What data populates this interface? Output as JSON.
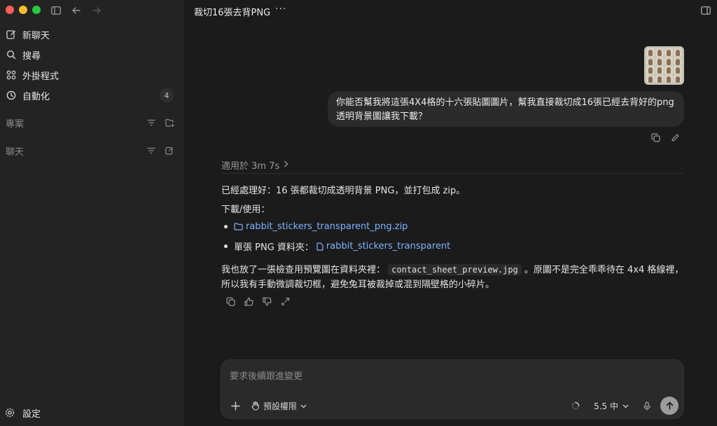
{
  "sidebar": {
    "items": [
      {
        "label": "新聊天",
        "icon": "new-chat-icon"
      },
      {
        "label": "搜尋",
        "icon": "search-icon"
      },
      {
        "label": "外掛程式",
        "icon": "plugins-icon"
      },
      {
        "label": "自動化",
        "icon": "clock-icon",
        "badge": "4"
      }
    ],
    "sections": [
      {
        "label": "專案"
      },
      {
        "label": "聊天"
      }
    ],
    "settings_label": "設定"
  },
  "header": {
    "title": "裁切16張去背PNG",
    "more": "···"
  },
  "conversation": {
    "user_message": "你能否幫我將這張4X4格的十六張貼圖圖片，幫我直接裁切成16張已經去背好的png透明背景圖讓我下載？",
    "worked_for": "適用於 3m 7s",
    "assistant": {
      "line1": "已經處理好：16 張都裁切成透明背景 PNG，並打包成 zip。",
      "line2": "下載/使用：",
      "bullet1_link": "rabbit_stickers_transparent_png.zip",
      "bullet2_prefix": "單張 PNG 資料夾：",
      "bullet2_link": "rabbit_stickers_transparent",
      "para_before": "我也放了一張檢查用預覽圖在資料夾裡：",
      "para_code": "contact_sheet_preview.jpg",
      "para_after": "。原圖不是完全乖乖待在 4x4 格線裡，所以我有手動微調裁切框，避免兔耳被裁掉或混到隔壁格的小碎片。"
    }
  },
  "composer": {
    "placeholder": "要求後續跟進變更",
    "permission": "預設權限",
    "model": "5.5 中"
  },
  "colors": {
    "link": "#7fb3ff",
    "background": "#1b1b1b",
    "sidebar": "#232323"
  }
}
